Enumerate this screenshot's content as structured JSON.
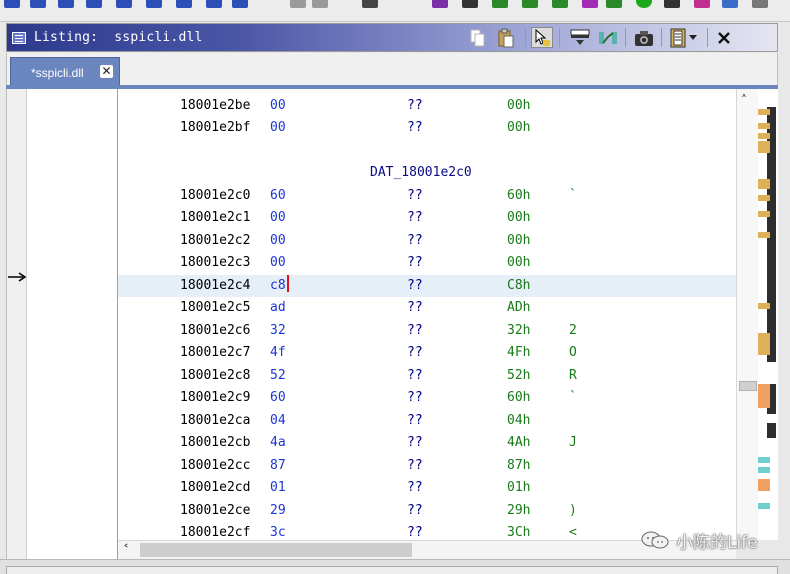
{
  "window": {
    "title": "Listing:  sspicli.dll"
  },
  "tab": {
    "label": "*sspicli.dll",
    "close": "✕"
  },
  "listing": {
    "rows": [
      {
        "addr": "18001e2be",
        "byte": "00",
        "mnem": "??",
        "val": "00h",
        "ch": ""
      },
      {
        "addr": "18001e2bf",
        "byte": "00",
        "mnem": "??",
        "val": "00h",
        "ch": ""
      },
      {
        "addr": "18001e2c0",
        "byte": "60",
        "mnem": "??",
        "val": "60h",
        "ch": "`"
      },
      {
        "addr": "18001e2c1",
        "byte": "00",
        "mnem": "??",
        "val": "00h",
        "ch": ""
      },
      {
        "addr": "18001e2c2",
        "byte": "00",
        "mnem": "??",
        "val": "00h",
        "ch": ""
      },
      {
        "addr": "18001e2c3",
        "byte": "00",
        "mnem": "??",
        "val": "00h",
        "ch": ""
      },
      {
        "addr": "18001e2c4",
        "byte": "c8",
        "mnem": "??",
        "val": "C8h",
        "ch": ""
      },
      {
        "addr": "18001e2c5",
        "byte": "ad",
        "mnem": "??",
        "val": "ADh",
        "ch": ""
      },
      {
        "addr": "18001e2c6",
        "byte": "32",
        "mnem": "??",
        "val": "32h",
        "ch": "2"
      },
      {
        "addr": "18001e2c7",
        "byte": "4f",
        "mnem": "??",
        "val": "4Fh",
        "ch": "O"
      },
      {
        "addr": "18001e2c8",
        "byte": "52",
        "mnem": "??",
        "val": "52h",
        "ch": "R"
      },
      {
        "addr": "18001e2c9",
        "byte": "60",
        "mnem": "??",
        "val": "60h",
        "ch": "`"
      },
      {
        "addr": "18001e2ca",
        "byte": "04",
        "mnem": "??",
        "val": "04h",
        "ch": ""
      },
      {
        "addr": "18001e2cb",
        "byte": "4a",
        "mnem": "??",
        "val": "4Ah",
        "ch": "J"
      },
      {
        "addr": "18001e2cc",
        "byte": "87",
        "mnem": "??",
        "val": "87h",
        "ch": ""
      },
      {
        "addr": "18001e2cd",
        "byte": "01",
        "mnem": "??",
        "val": "01h",
        "ch": ""
      },
      {
        "addr": "18001e2ce",
        "byte": "29",
        "mnem": "??",
        "val": "29h",
        "ch": ")"
      },
      {
        "addr": "18001e2cf",
        "byte": "3c",
        "mnem": "??",
        "val": "3Ch",
        "ch": "<"
      }
    ],
    "data_label": "DAT_18001e2c0",
    "current_address": "18001e2c4"
  },
  "scroll": {
    "up_arrow": "˄",
    "left_arrow": "˂"
  },
  "watermark": {
    "text": "小陈的Life"
  },
  "colors": {
    "address": "#000000",
    "bytes": "#1c35d6",
    "mnemonic": "#000080",
    "value": "#197a19",
    "title_gradient_start": "#2d3a8c",
    "tab": "#6b86bf",
    "cursor": "#dd1111",
    "current_line": "#e6eef8"
  },
  "icons": {
    "toolbar": [
      "copy-icon",
      "paste-icon",
      "cursor-select-icon",
      "field-layout-icon",
      "graph-icon",
      "snapshot-icon",
      "columns-icon",
      "dropdown-icon",
      "close-icon"
    ]
  }
}
